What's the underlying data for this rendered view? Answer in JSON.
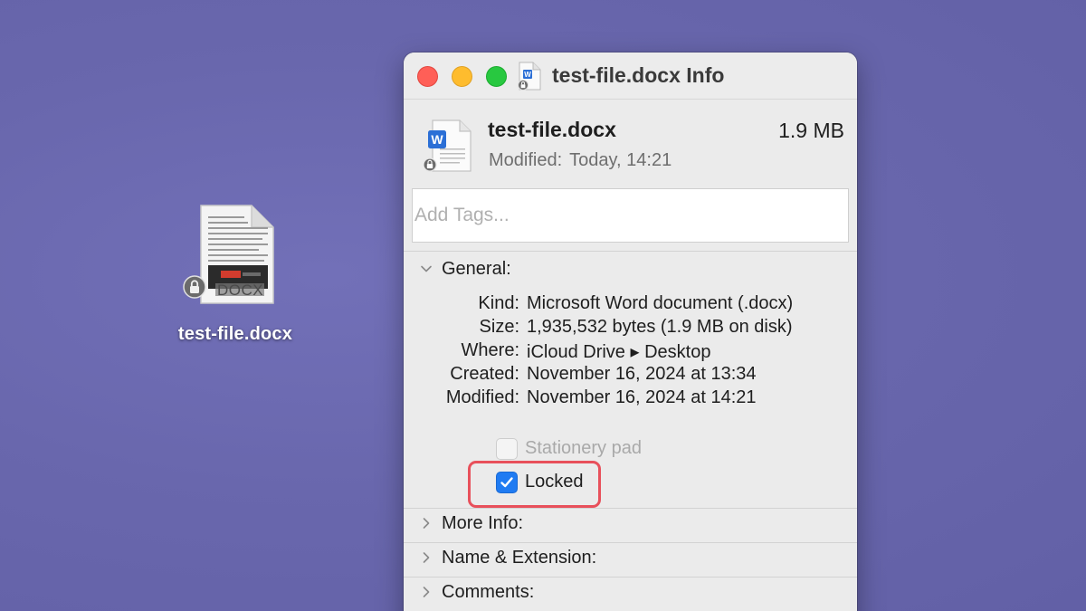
{
  "desktop": {
    "icon_label": "test-file.docx",
    "icon_badge_text": "DOCX"
  },
  "window": {
    "title": "test-file.docx Info"
  },
  "header": {
    "file_name": "test-file.docx",
    "file_size": "1.9 MB",
    "modified_label": "Modified:",
    "modified_value": "Today, 14:21",
    "tags_placeholder": "Add Tags..."
  },
  "general": {
    "title": "General:",
    "expanded": true,
    "rows": [
      {
        "key": "Kind:",
        "value": "Microsoft Word document (.docx)"
      },
      {
        "key": "Size:",
        "value": "1,935,532 bytes (1.9 MB on disk)"
      },
      {
        "key": "Where:",
        "value": "iCloud Drive ▸ Desktop"
      },
      {
        "key": "Created:",
        "value": "November 16, 2024 at 13:34"
      },
      {
        "key": "Modified:",
        "value": "November 16, 2024 at 14:21"
      }
    ],
    "stationery_label": "Stationery pad",
    "stationery_checked": false,
    "locked_label": "Locked",
    "locked_checked": true
  },
  "sections": [
    {
      "title": "More Info:",
      "expanded": false
    },
    {
      "title": "Name & Extension:",
      "expanded": false
    },
    {
      "title": "Comments:",
      "expanded": false
    }
  ],
  "colors": {
    "desktop_bg": "#6967ad",
    "checkbox_accent": "#1f7bf2",
    "highlight": "#e8505b",
    "word_blue": "#2b6fd6"
  }
}
